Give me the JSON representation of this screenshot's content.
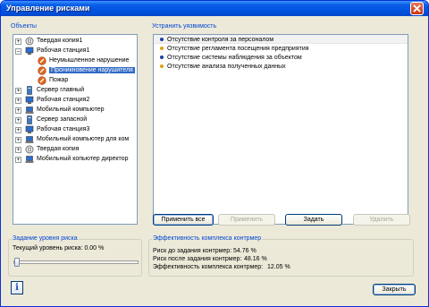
{
  "window": {
    "title": "Управление рисками"
  },
  "objects_panel": {
    "label": "Объекты",
    "tree": [
      {
        "level": 0,
        "expander": "+",
        "icon": "hard-copy-icon",
        "label": "Твердая копия1"
      },
      {
        "level": 0,
        "expander": "−",
        "icon": "workstation-icon",
        "label": "Рабочая станция1"
      },
      {
        "level": 1,
        "expander": "",
        "icon": "threat-icon",
        "label": "Неумышленное нарушение"
      },
      {
        "level": 1,
        "expander": "",
        "icon": "threat-icon",
        "label": "Проникновение нарушителя",
        "selected": true
      },
      {
        "level": 1,
        "expander": "",
        "icon": "threat-icon",
        "label": "Пожар"
      },
      {
        "level": 0,
        "expander": "+",
        "icon": "server-icon",
        "label": "Сервер главный"
      },
      {
        "level": 0,
        "expander": "+",
        "icon": "workstation-icon",
        "label": "Рабочая станция2"
      },
      {
        "level": 0,
        "expander": "+",
        "icon": "laptop-icon",
        "label": "Мобильный компьютер"
      },
      {
        "level": 0,
        "expander": "+",
        "icon": "server-icon",
        "label": "Сервер запасной"
      },
      {
        "level": 0,
        "expander": "+",
        "icon": "workstation-icon",
        "label": "Рабочая станция3"
      },
      {
        "level": 0,
        "expander": "+",
        "icon": "laptop-icon",
        "label": "Мобильный компьютер для ком"
      },
      {
        "level": 0,
        "expander": "+",
        "icon": "hard-copy-icon",
        "label": "Твердая копия"
      },
      {
        "level": 0,
        "expander": "+",
        "icon": "laptop-icon",
        "label": "Мобильный копьютер директор"
      }
    ]
  },
  "vulnerabilities_panel": {
    "label": "Устранить уязвимость",
    "items": [
      {
        "label": "Отсутствие контроля за персоналом",
        "color": "#1f3fa0"
      },
      {
        "label": "Отсутствие регламента посещения предприятия",
        "color": "#d9a21b"
      },
      {
        "label": "Отсутствие системы наблюдения за объектом",
        "color": "#1f3fa0"
      },
      {
        "label": "Отсутствие анализа полученных данных",
        "color": "#d9a21b"
      }
    ],
    "buttons": {
      "apply_all": "Применить все",
      "apply": "Применить",
      "set": "Задать",
      "delete": "Удалить"
    }
  },
  "risk_panel": {
    "label": "Задание уровня риска",
    "current_level": "Текущий уровень риска: 0.00 %",
    "slider_value": 0.0
  },
  "effectiveness_panel": {
    "label": "Эффективность комплекса контрмер",
    "risk_before": "Риск до задания контрмер:",
    "risk_before_value": "54.76 %",
    "risk_after": "Риск после задания контрмер:",
    "risk_after_value": "48.16 %",
    "efficiency": "Эффективность комплекса контрмер:",
    "efficiency_value": "12.05 %"
  },
  "footer": {
    "close_label": "Закрыть"
  }
}
